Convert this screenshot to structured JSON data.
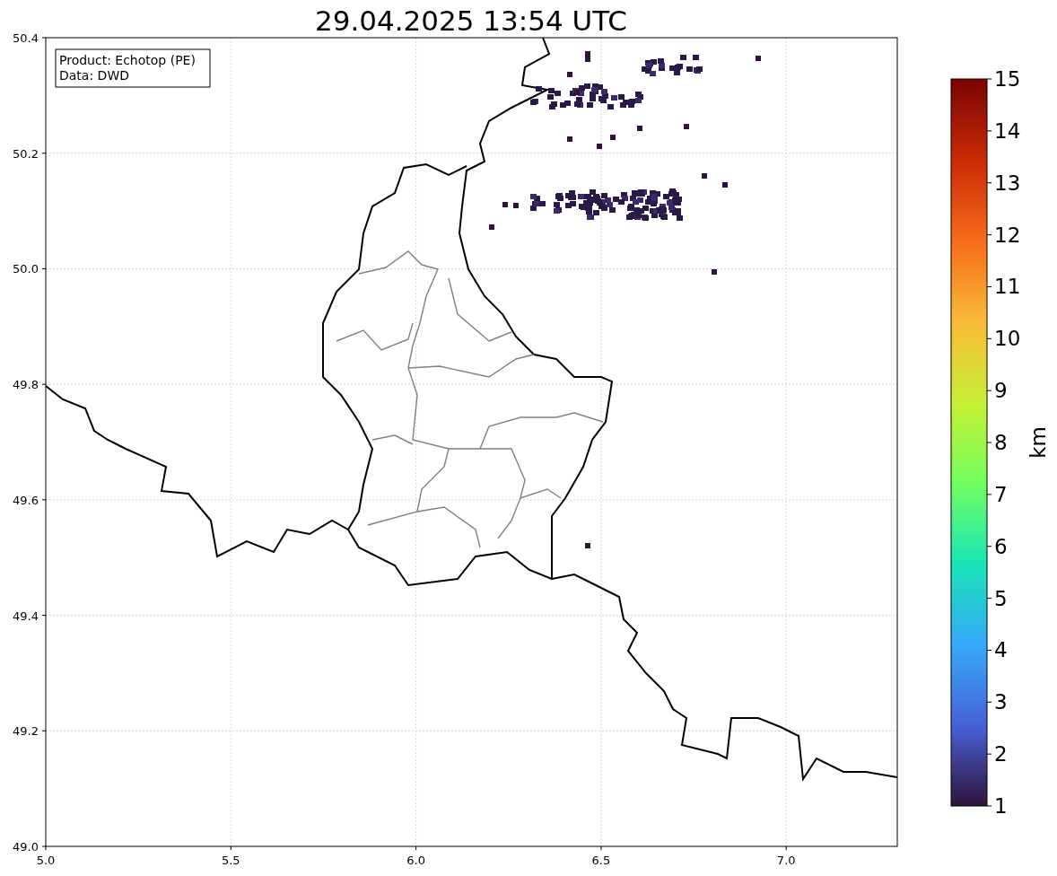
{
  "title": "29.04.2025 13:54 UTC",
  "legend": [
    "Product: Echotop (PE)",
    "Data: DWD"
  ],
  "x_ticks": [
    "5.0",
    "5.5",
    "6.0",
    "6.5",
    "7.0"
  ],
  "y_ticks": [
    "50.4",
    "50.2",
    "50.0",
    "49.8",
    "49.6",
    "49.4",
    "49.2",
    "49.0"
  ],
  "colorbar": {
    "label": "km",
    "ticks": [
      "15",
      "14",
      "13",
      "12",
      "11",
      "10",
      "9",
      "8",
      "7",
      "6",
      "5",
      "4",
      "3",
      "2",
      "1"
    ]
  }
}
